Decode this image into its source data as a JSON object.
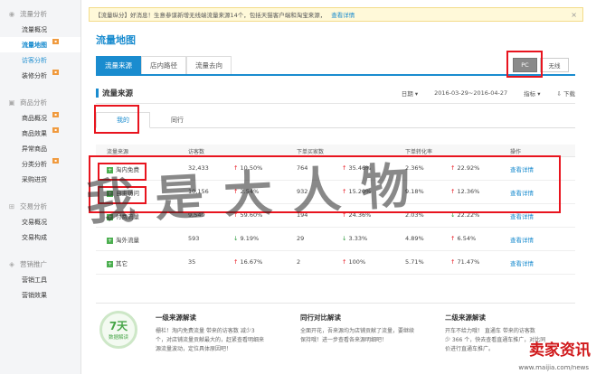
{
  "sidebar": {
    "groups": [
      {
        "icon": "eye-icon",
        "title": "流量分析",
        "items": [
          {
            "label": "流量概况",
            "active": false,
            "badge": false
          },
          {
            "label": "流量地图",
            "active": true,
            "badge": true
          },
          {
            "label": "访客分析",
            "active": false,
            "badge": false,
            "hl": true
          },
          {
            "label": "装修分析",
            "active": false,
            "badge": true
          }
        ]
      },
      {
        "icon": "box-icon",
        "title": "商品分析",
        "items": [
          {
            "label": "商品概况",
            "active": false,
            "badge": true
          },
          {
            "label": "商品效果",
            "active": false,
            "badge": true
          },
          {
            "label": "异常商品",
            "active": false,
            "badge": false
          },
          {
            "label": "分类分析",
            "active": false,
            "badge": true
          },
          {
            "label": "采购进货",
            "active": false,
            "badge": false
          }
        ]
      },
      {
        "icon": "cart-icon",
        "title": "交易分析",
        "items": [
          {
            "label": "交易概况",
            "active": false,
            "badge": false
          },
          {
            "label": "交易构成",
            "active": false,
            "badge": false
          }
        ]
      },
      {
        "icon": "tag-icon",
        "title": "营销推广",
        "items": [
          {
            "label": "营销工具",
            "active": false,
            "badge": false
          },
          {
            "label": "营销效果",
            "active": false,
            "badge": false
          }
        ]
      }
    ]
  },
  "notice": {
    "text": "【流量纵分】好消息！生意参谋新增无线端流量来源14个，包括天猫客户端和淘宝来源，",
    "link": "查看详情",
    "close": "×"
  },
  "page_title": "流量地图",
  "tabs": [
    "流量来源",
    "店内路径",
    "流量去向"
  ],
  "device": {
    "pc": "PC",
    "wireless": "无线"
  },
  "section": {
    "title": "流量来源",
    "period_label": "日期",
    "date_range": "2016-03-29~2016-04-27",
    "metric_label": "指标",
    "download": "下载"
  },
  "subtabs": [
    "我的",
    "同行"
  ],
  "table": {
    "headers": [
      "流量来源",
      "访客数",
      "下单买家数",
      "下单转化率",
      "操作"
    ],
    "rows": [
      {
        "source": "淘内免费",
        "visitors": "32,433",
        "v_change": "10.50%",
        "v_dir": "up",
        "buyers": "764",
        "b_change": "35.46%",
        "b_dir": "up",
        "rate": "2.36%",
        "r_change": "22.92%",
        "r_dir": "up",
        "action": "查看详情"
      },
      {
        "source": "自主访问",
        "visitors": "10,156",
        "v_change": "2.54%",
        "v_dir": "up",
        "buyers": "932",
        "b_change": "15.20%",
        "b_dir": "up",
        "rate": "9.18%",
        "r_change": "12.36%",
        "r_dir": "up",
        "action": "查看详情"
      },
      {
        "source": "付费流量",
        "visitors": "9,549",
        "v_change": "59.60%",
        "v_dir": "up",
        "buyers": "194",
        "b_change": "24.36%",
        "b_dir": "up",
        "rate": "2.03%",
        "r_change": "22.22%",
        "r_dir": "down",
        "action": "查看详情"
      },
      {
        "source": "淘外流量",
        "visitors": "593",
        "v_change": "9.19%",
        "v_dir": "down",
        "buyers": "29",
        "b_change": "3.33%",
        "b_dir": "down",
        "rate": "4.89%",
        "r_change": "6.54%",
        "r_dir": "up",
        "action": "查看详情"
      },
      {
        "source": "其它",
        "visitors": "35",
        "v_change": "16.67%",
        "v_dir": "up",
        "buyers": "2",
        "b_change": "100%",
        "b_dir": "up",
        "rate": "5.71%",
        "r_change": "71.47%",
        "r_dir": "up",
        "action": "查看详情"
      }
    ]
  },
  "watermark": "我是大人物",
  "bottom": {
    "circle_big": "7天",
    "circle_small": "数据解读",
    "cols": [
      {
        "title": "一级来源解读",
        "l1": "栅栏！淘内免费流量 带来的访客数 减少3",
        "l2": "个，对店铺流量贡献最大的，赶紧查看明细来",
        "l3": "源流量波动，定位具体原因吧！"
      },
      {
        "title": "同行对比解读",
        "l1": "全面开花，吾来源均为店铺贡献了流量，要继续",
        "l2": "保持哦！进一步查看各来源明细吧！",
        "l3": ""
      },
      {
        "title": "二级来源解读",
        "l1": "开车不给力哦！ 直通车 带来的访客数",
        "l2": "少 366 个，快去查看直通车推广，对比同",
        "l3": "价进行直通车推广。"
      }
    ]
  },
  "site": {
    "logo": "卖家资讯",
    "url": "www.maijia.com/news"
  }
}
